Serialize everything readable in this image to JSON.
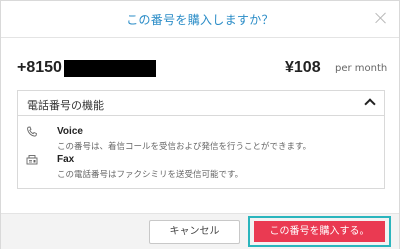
{
  "dialog": {
    "title": "この番号を購入しますか？"
  },
  "number": {
    "phone_prefix": "+8150",
    "price": "¥108",
    "per": "per month"
  },
  "features": {
    "heading": "電話番号の機能",
    "items": [
      {
        "icon": "phone-icon",
        "name": "Voice",
        "desc": "この番号は、着信コールを受信および発信を行うことができます。"
      },
      {
        "icon": "fax-icon",
        "name": "Fax",
        "desc": "この電話番号はファクシミリを送受信可能です。"
      }
    ]
  },
  "footer": {
    "cancel_label": "キャンセル",
    "buy_label": "この番号を購入する。"
  },
  "colors": {
    "title": "#2a8cc7",
    "primary_button": "#ea3a52",
    "focus_ring": "#2ab5bd"
  }
}
